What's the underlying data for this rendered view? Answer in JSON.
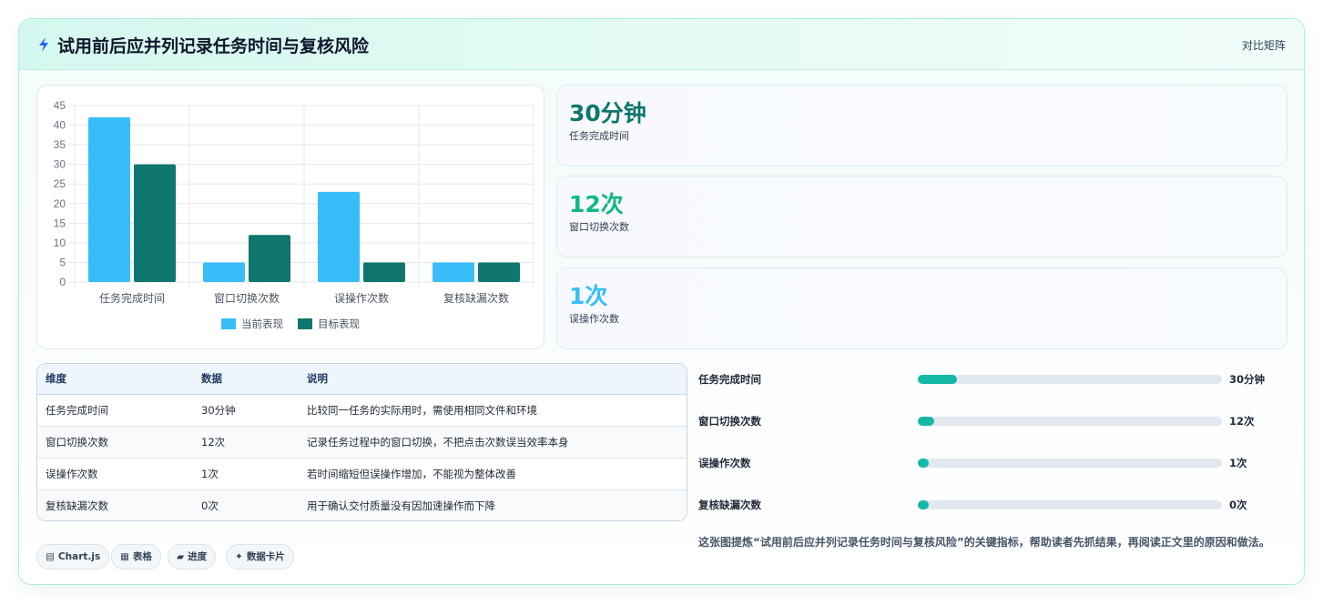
{
  "header": {
    "title": "试用前后应并列记录任务时间与复核风险",
    "badge": "对比矩阵",
    "icon": "lightning-icon"
  },
  "chart_data": {
    "type": "bar",
    "categories": [
      "任务完成时间",
      "窗口切换次数",
      "误操作次数",
      "复核缺漏次数"
    ],
    "series": [
      {
        "name": "当前表现",
        "values": [
          42,
          5,
          23,
          5
        ],
        "color": "#38bdf8"
      },
      {
        "name": "目标表现",
        "values": [
          30,
          12,
          5,
          5
        ],
        "color": "#0f766e"
      }
    ],
    "yticks": [
      "0",
      "5",
      "10",
      "15",
      "20",
      "25",
      "30",
      "35",
      "40",
      "45"
    ],
    "ylim": [
      0,
      45
    ],
    "grid": true,
    "legend": "bottom"
  },
  "stats": [
    {
      "value": "30分钟",
      "label": "任务完成时间",
      "color": "#0f766e"
    },
    {
      "value": "12次",
      "label": "窗口切换次数",
      "color": "#10b981"
    },
    {
      "value": "1次",
      "label": "误操作次数",
      "color": "#38bdf8"
    }
  ],
  "table": {
    "headers": [
      "维度",
      "数据",
      "说明"
    ],
    "rows": [
      [
        "任务完成时间",
        "30分钟",
        "比较同一任务的实际用时，需使用相同文件和环境"
      ],
      [
        "窗口切换次数",
        "12次",
        "记录任务过程中的窗口切换，不把点击次数误当效率本身"
      ],
      [
        "误操作次数",
        "1次",
        "若时间缩短但误操作增加，不能视为整体改善"
      ],
      [
        "复核缺漏次数",
        "0次",
        "用于确认交付质量没有因加速操作而下降"
      ]
    ]
  },
  "progress": [
    {
      "label": "任务完成时间",
      "value": "30分钟",
      "fraction": 0.13
    },
    {
      "label": "窗口切换次数",
      "value": "12次",
      "fraction": 0.055
    },
    {
      "label": "误操作次数",
      "value": "1次",
      "fraction": 0.035
    },
    {
      "label": "复核缺漏次数",
      "value": "0次",
      "fraction": 0.035
    }
  ],
  "tags": [
    {
      "icon": "chart-icon",
      "glyph": "▤",
      "label": "Chart.js"
    },
    {
      "icon": "table-icon",
      "glyph": "▦",
      "label": "表格"
    },
    {
      "icon": "progress-icon",
      "glyph": "▰",
      "label": "进度"
    },
    {
      "icon": "sparkle-icon",
      "glyph": "✦",
      "label": "数据卡片"
    }
  ],
  "note": "这张图提炼“试用前后应并列记录任务时间与复核风险”的关键指标，帮助读者先抓结果，再阅读正文里的原因和做法。"
}
